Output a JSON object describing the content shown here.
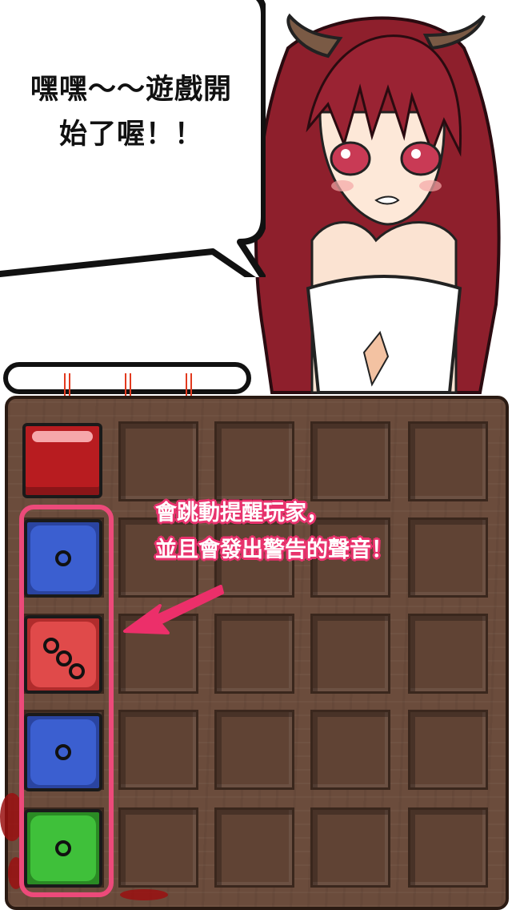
{
  "speech_bubble": {
    "line1": "嘿嘿～～遊戲開",
    "line2": "始了喔！！"
  },
  "annotation": {
    "line1": "會跳動提醒玩家，",
    "line2": "並且會發出警告的聲音！"
  },
  "colors": {
    "accent": "#ec4a7a",
    "board": "#6b4c3c",
    "die_blue": "#3b5fd0",
    "die_red": "#e04a4a",
    "die_green": "#3fc03a",
    "next_block": "#b81c20"
  },
  "queue_dice": [
    {
      "color": "blue",
      "pips": 1
    },
    {
      "color": "red",
      "pips": 3
    },
    {
      "color": "blue",
      "pips": 1
    },
    {
      "color": "green",
      "pips": 1
    }
  ],
  "next_block": {
    "color": "red"
  },
  "icons": [
    "warning-arrow-icon"
  ]
}
